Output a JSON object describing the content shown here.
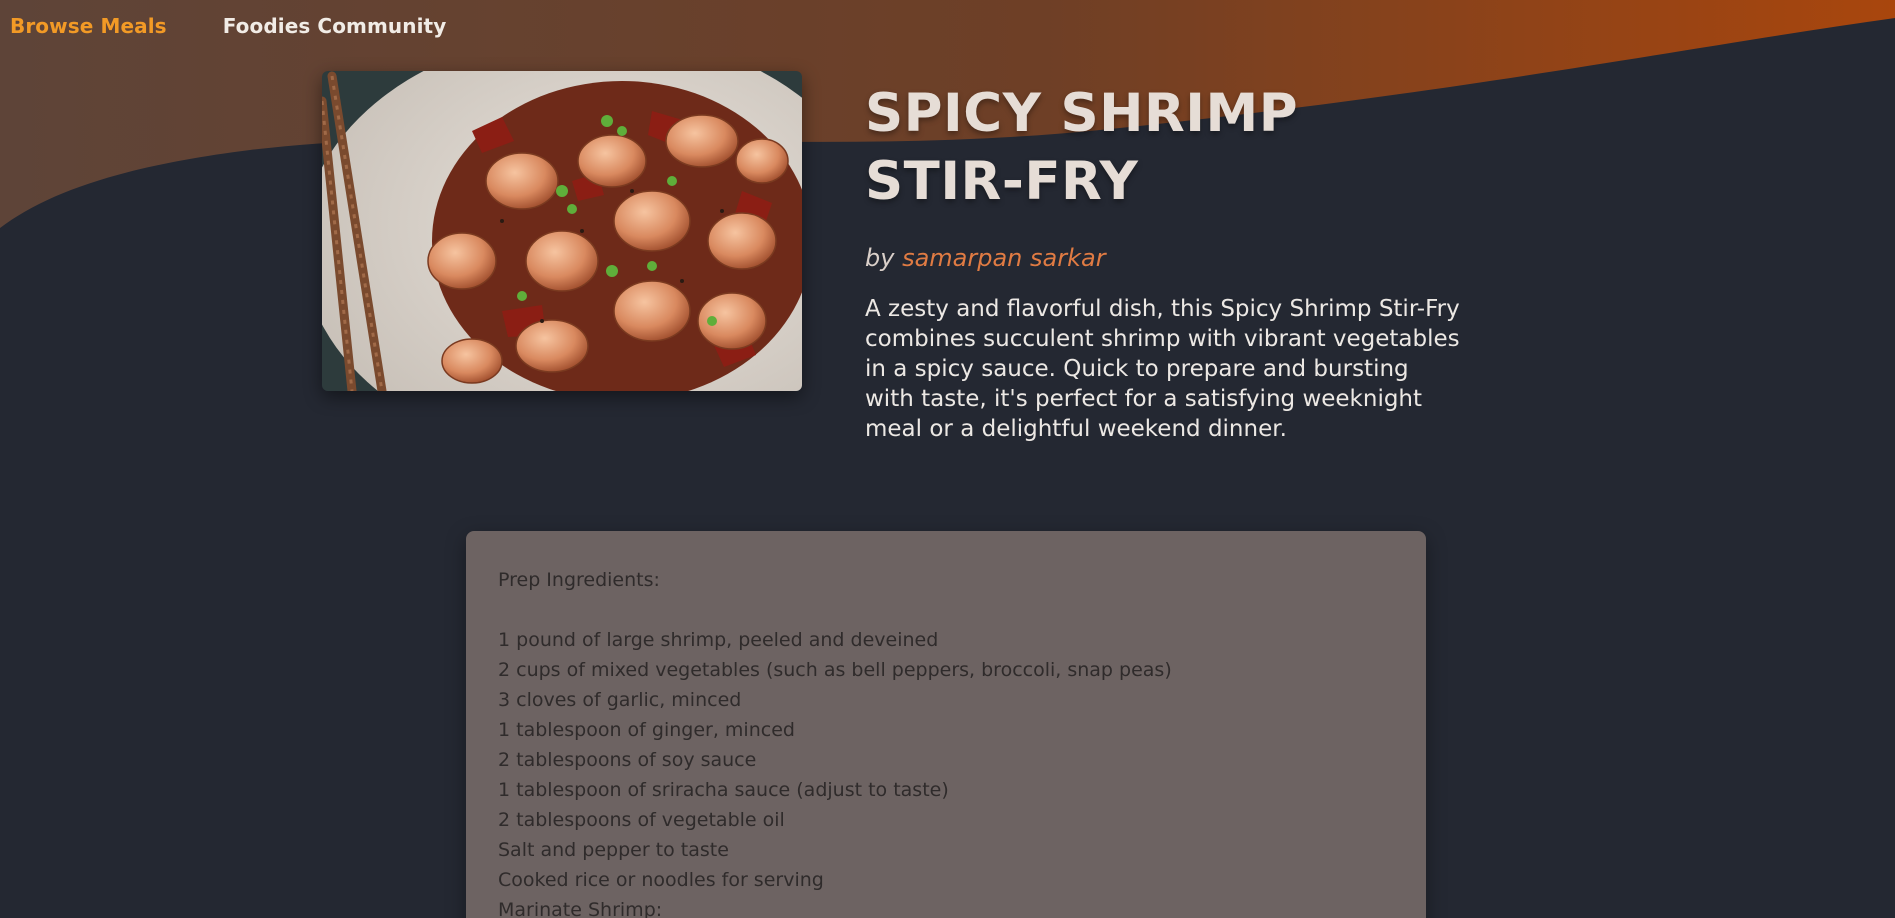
{
  "nav": {
    "browse_label": "Browse Meals",
    "community_label": "Foodies Community"
  },
  "colors": {
    "background": "#242832",
    "accent": "#f29a26",
    "header_wave_start": "#5c4338",
    "header_wave_end": "#b0470c",
    "author": "#e07b43",
    "card": "#6d6362"
  },
  "recipe": {
    "title": "SPICY SHRIMP STIR-FRY",
    "by_label": "by",
    "author": "samarpan sarkar",
    "description": "A zesty and flavorful dish, this Spicy Shrimp Stir-Fry combines succulent shrimp with vibrant vegetables in a spicy sauce. Quick to prepare and bursting with taste, it's perfect for a satisfying weeknight meal or a delightful weekend dinner.",
    "image_icon": "shrimp-stir-fry-photo"
  },
  "instructions": {
    "heading": "Prep Ingredients:",
    "lines": [
      "1 pound of large shrimp, peeled and deveined",
      "2 cups of mixed vegetables (such as bell peppers, broccoli, snap peas)",
      "3 cloves of garlic, minced",
      "1 tablespoon of ginger, minced",
      "2 tablespoons of soy sauce",
      "1 tablespoon of sriracha sauce (adjust to taste)",
      "2 tablespoons of vegetable oil",
      "Salt and pepper to taste",
      "Cooked rice or noodles for serving",
      "Marinate Shrimp:"
    ]
  }
}
